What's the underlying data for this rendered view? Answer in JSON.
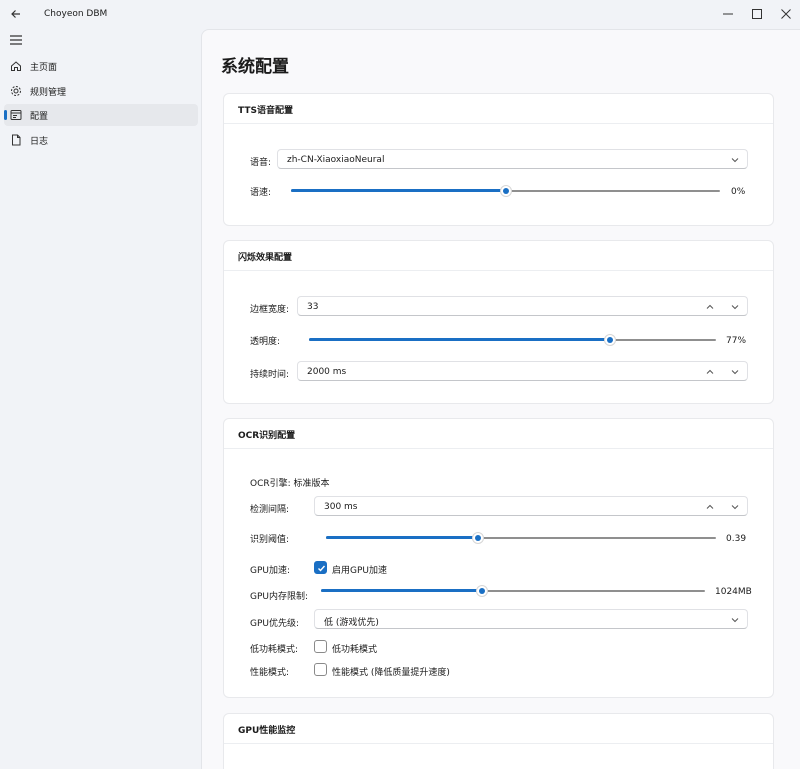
{
  "app": {
    "title": "Choyeon DBM"
  },
  "sidebar": {
    "items": [
      {
        "label": "主页面"
      },
      {
        "label": "规则管理"
      },
      {
        "label": "配置"
      },
      {
        "label": "日志"
      }
    ]
  },
  "page": {
    "title": "系统配置"
  },
  "tts": {
    "header": "TTS语音配置",
    "voice_label": "语音:",
    "voice_value": "zh-CN-XiaoxiaoNeural",
    "speed_label": "语速:",
    "speed_value": "0%",
    "speed_fraction": 0.5
  },
  "flash": {
    "header": "闪烁效果配置",
    "border_label": "边框宽度:",
    "border_value": "33",
    "opacity_label": "透明度:",
    "opacity_value": "77%",
    "opacity_fraction": 0.74,
    "duration_label": "持续时间:",
    "duration_value": "2000 ms"
  },
  "ocr": {
    "header": "OCR识别配置",
    "engine_text": "OCR引擎: 标准版本",
    "interval_label": "检测间隔:",
    "interval_value": "300 ms",
    "threshold_label": "识别阈值:",
    "threshold_value": "0.39",
    "threshold_fraction": 0.39,
    "gpu_accel_label": "GPU加速:",
    "gpu_accel_check": "启用GPU加速",
    "gpu_mem_label": "GPU内存限制:",
    "gpu_mem_value": "1024MB",
    "gpu_mem_fraction": 0.42,
    "gpu_priority_label": "GPU优先级:",
    "gpu_priority_value": "低 (游戏优先)",
    "low_power_label": "低功耗模式:",
    "low_power_check": "低功耗模式",
    "perf_label": "性能模式:",
    "perf_check": "性能模式 (降低质量提升速度)"
  },
  "gpu_monitor": {
    "header": "GPU性能监控"
  },
  "colors": {
    "accent": "#1a6fc4"
  }
}
